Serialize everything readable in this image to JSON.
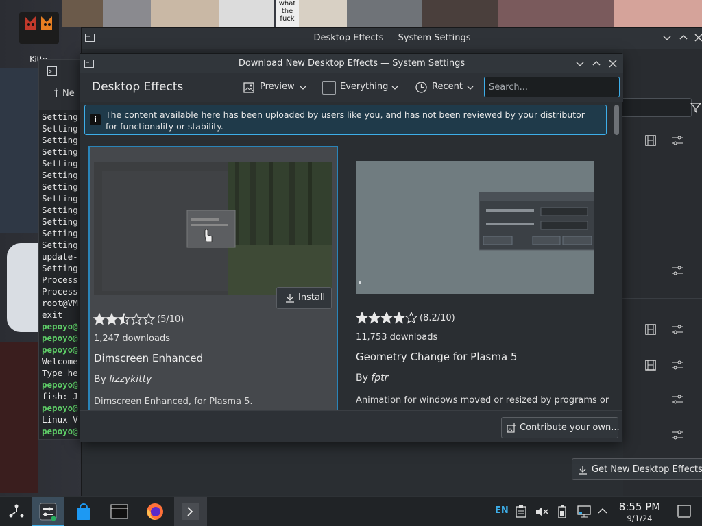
{
  "wallpaper": {
    "top_text": "what the fuck"
  },
  "desktop_icon": {
    "label": "Kitty"
  },
  "terminal": {
    "new_tab_label": "Ne",
    "lines": [
      {
        "text": "Setting",
        "color": "white"
      },
      {
        "text": "Setting",
        "color": "white"
      },
      {
        "text": "Setting",
        "color": "white"
      },
      {
        "text": "Setting",
        "color": "white"
      },
      {
        "text": "Setting",
        "color": "white"
      },
      {
        "text": "Setting",
        "color": "white"
      },
      {
        "text": "Setting",
        "color": "white"
      },
      {
        "text": "Setting",
        "color": "white"
      },
      {
        "text": "Setting",
        "color": "white"
      },
      {
        "text": "Setting",
        "color": "white"
      },
      {
        "text": "Setting",
        "color": "white"
      },
      {
        "text": "Setting",
        "color": "white"
      },
      {
        "text": "update-",
        "color": "white"
      },
      {
        "text": "Setting",
        "color": "white"
      },
      {
        "text": "Process",
        "color": "white"
      },
      {
        "text": "Process",
        "color": "white"
      },
      {
        "text": "root@VM",
        "color": "white"
      },
      {
        "text": "exit",
        "color": "white"
      },
      {
        "text": "pepoyo@",
        "color": "green"
      },
      {
        "text": "pepoyo@",
        "color": "green"
      },
      {
        "text": "pepoyo@",
        "color": "green"
      },
      {
        "text": "Welcome",
        "color": "white"
      },
      {
        "text": "Type he",
        "color": "white"
      },
      {
        "text": "pepoyo@",
        "color": "green"
      },
      {
        "text": "fish: J",
        "color": "white"
      },
      {
        "text": "pepoyo@",
        "color": "green"
      },
      {
        "text": "Linux V",
        "color": "white"
      },
      {
        "text": "pepoyo@",
        "color": "green"
      }
    ]
  },
  "system_settings": {
    "title": "Desktop Effects — System Settings",
    "get_new_button": "Get New Desktop Effects..."
  },
  "dialog": {
    "title": "Download New Desktop Effects — System Settings",
    "heading": "Desktop Effects",
    "toolbar": {
      "preview_label": "Preview",
      "filter_label": "Everything",
      "sort_label": "Recent",
      "search_placeholder": "Search..."
    },
    "notice": "The content available here has been uploaded by users like you, and has not been reviewed by your distributor for functionality or stability.",
    "cards": [
      {
        "rating": 5,
        "rating_text": "(5/10)",
        "downloads": "1,247 downloads",
        "title": "Dimscreen Enhanced",
        "by": "By",
        "author": "lizzykitty",
        "description": "Dimscreen Enhanced, for Plasma 5.",
        "install_label": "Install"
      },
      {
        "rating": 8.2,
        "rating_text": "(8.2/10)",
        "downloads": "11,753 downloads",
        "title": "Geometry Change for Plasma 5",
        "by": "By",
        "author": "fptr",
        "description": "Animation for windows moved or resized by programs or"
      }
    ],
    "contribute_label": "Contribute your own..."
  },
  "taskbar": {
    "language": "EN",
    "time": "8:55 PM",
    "date": "9/1/24"
  },
  "colors": {
    "accent": "#3daee9",
    "star": "#e8e8e8"
  }
}
